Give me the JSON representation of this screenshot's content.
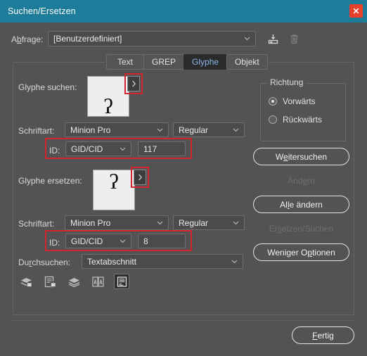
{
  "window": {
    "title": "Suchen/Ersetzen",
    "close_icon": "close-icon",
    "titlebar_color": "#1c7c99",
    "close_color": "#e8402a",
    "background_color": "#535353",
    "accent_color": "#8ab6e8",
    "annotation_color": "#d3252b"
  },
  "query": {
    "label_pre": "A",
    "label_underlined": "b",
    "label_post": "frage:",
    "label": "Abfrage:",
    "value": "[Benutzerdefiniert]",
    "caret_icon": "chevron-down-icon",
    "save_icon": "save-query-icon",
    "delete_icon": "trash-icon"
  },
  "tabs": [
    {
      "label": "Text",
      "active": false
    },
    {
      "label": "GREP",
      "active": false
    },
    {
      "label": "Glyphe",
      "active": true
    },
    {
      "label": "Objekt",
      "active": false
    }
  ],
  "find": {
    "label": "Glyphe suchen:",
    "glyph": "ʔ",
    "glyph_dropdown_icon": "chevron-right-icon",
    "font_label_pre": "Schriftart:",
    "font_label": "Schriftart:",
    "font_family": "Minion Pro",
    "font_style": "Regular",
    "id_label": "ID:",
    "id_type": "GID/CID",
    "id_value": "117"
  },
  "replace": {
    "label": "Glyphe ersetzen:",
    "glyph": "ʔ",
    "glyph_dropdown_icon": "chevron-right-icon",
    "font_label": "Schriftart:",
    "font_family": "Minion Pro",
    "font_style": "Regular",
    "id_label": "ID:",
    "id_type": "GID/CID",
    "id_value": "8"
  },
  "scope": {
    "label_pre": "Du",
    "label_underlined": "r",
    "label_post": "chsuchen:",
    "label": "Durchsuchen:",
    "value": "Textabschnitt",
    "icons": [
      {
        "name": "include-locked-layers-icon",
        "active": false
      },
      {
        "name": "include-locked-stories-icon",
        "active": false
      },
      {
        "name": "include-hidden-layers-icon",
        "active": false
      },
      {
        "name": "include-master-pages-icon",
        "active": false
      },
      {
        "name": "include-footnotes-icon",
        "active": true
      }
    ]
  },
  "direction": {
    "legend": "Richtung",
    "options": [
      {
        "label": "Vorwärts",
        "checked": true
      },
      {
        "label": "Rückwärts",
        "checked": false
      }
    ]
  },
  "buttons": [
    {
      "label": "Weitersuchen",
      "underline_index": 1,
      "disabled": false,
      "name": "find-next-button"
    },
    {
      "label": "Ändern",
      "underline_index": 3,
      "disabled": true,
      "name": "change-button"
    },
    {
      "label": "Alle ändern",
      "underline_index": 2,
      "disabled": false,
      "name": "change-all-button"
    },
    {
      "label": "Ersetzen/Suchen",
      "underline_index": 2,
      "disabled": true,
      "name": "change-find-button"
    },
    {
      "label": "Weniger Optionen",
      "underline_index": 10,
      "disabled": false,
      "name": "fewer-options-button"
    }
  ],
  "footer": {
    "done_pre": "",
    "done_underlined": "F",
    "done_post": "ertig",
    "done_label": "Fertig"
  }
}
